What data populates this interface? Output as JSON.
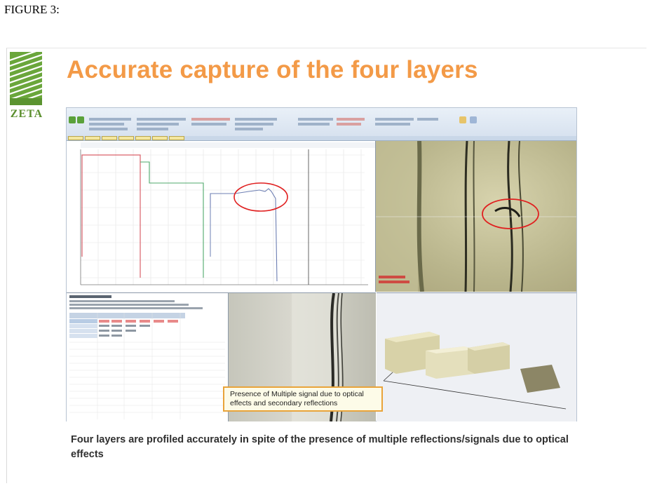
{
  "figure_label": "FIGURE 3:",
  "logo_text": "ZETA",
  "title": "Accurate capture of the four layers",
  "callout_text": "Presence of Multiple signal due to optical effects and secondary reflections",
  "caption": "Four layers are profiled accurately in spite of the presence of multiple reflections/signals due to optical effects",
  "colors": {
    "title": "#f39a47",
    "logo_green": "#6aa63b",
    "callout_border": "#e9a43a",
    "highlight_circle": "#e02020"
  }
}
